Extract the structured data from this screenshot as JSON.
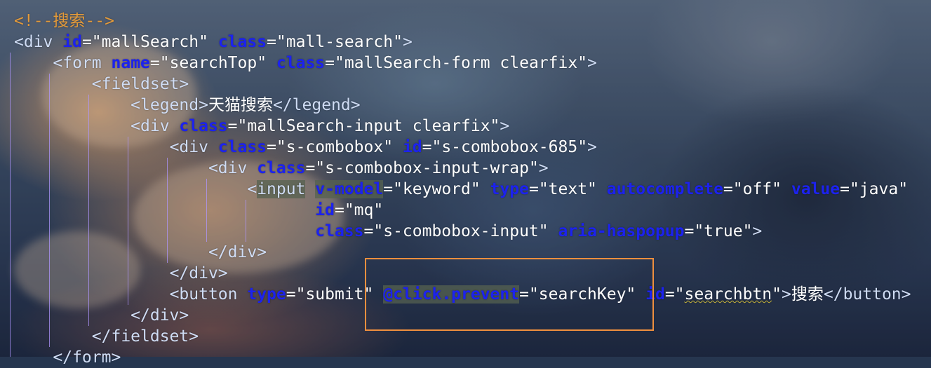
{
  "editor": {
    "lines": [
      {
        "segments": [
          {
            "t": "<!--搜索-->",
            "c": "cmt"
          }
        ]
      },
      {
        "segments": [
          {
            "t": "<div",
            "c": "tag"
          },
          {
            "t": " "
          },
          {
            "t": "id",
            "c": "attr"
          },
          {
            "t": "=\"mallSearch\" ",
            "c": "val"
          },
          {
            "t": "class",
            "c": "attr"
          },
          {
            "t": "=\"mall-search\"",
            "c": "val"
          },
          {
            "t": ">",
            "c": "tag"
          }
        ]
      },
      {
        "segments": [
          {
            "t": "    "
          },
          {
            "t": "<form",
            "c": "tag"
          },
          {
            "t": " "
          },
          {
            "t": "name",
            "c": "attr"
          },
          {
            "t": "=\"searchTop\" ",
            "c": "val"
          },
          {
            "t": "class",
            "c": "attr"
          },
          {
            "t": "=\"mallSearch-form clearfix\"",
            "c": "val"
          },
          {
            "t": ">",
            "c": "tag"
          }
        ]
      },
      {
        "segments": [
          {
            "t": "        "
          },
          {
            "t": "<fieldset>",
            "c": "tag"
          }
        ]
      },
      {
        "segments": [
          {
            "t": "            "
          },
          {
            "t": "<legend>",
            "c": "tag"
          },
          {
            "t": "天猫搜索",
            "c": "val"
          },
          {
            "t": "</legend>",
            "c": "tag"
          }
        ]
      },
      {
        "segments": [
          {
            "t": "            "
          },
          {
            "t": "<div",
            "c": "tag"
          },
          {
            "t": " "
          },
          {
            "t": "class",
            "c": "attr"
          },
          {
            "t": "=\"mallSearch-input clearfix\"",
            "c": "val"
          },
          {
            "t": ">",
            "c": "tag"
          }
        ]
      },
      {
        "segments": [
          {
            "t": "                "
          },
          {
            "t": "<div",
            "c": "tag"
          },
          {
            "t": " "
          },
          {
            "t": "class",
            "c": "attr"
          },
          {
            "t": "=\"s-combobox\" ",
            "c": "val"
          },
          {
            "t": "id",
            "c": "attr"
          },
          {
            "t": "=\"s-combobox-685\"",
            "c": "val"
          },
          {
            "t": ">",
            "c": "tag"
          }
        ]
      },
      {
        "segments": [
          {
            "t": "                    "
          },
          {
            "t": "<div",
            "c": "tag"
          },
          {
            "t": " "
          },
          {
            "t": "class",
            "c": "attr"
          },
          {
            "t": "=\"s-combobox-input-wrap\"",
            "c": "val"
          },
          {
            "t": ">",
            "c": "tag"
          }
        ]
      },
      {
        "segments": [
          {
            "t": "                        "
          },
          {
            "t": "<",
            "c": "tag"
          },
          {
            "t": "input",
            "c": "tag hl"
          },
          {
            "t": " "
          },
          {
            "t": "v-model",
            "c": "attr hl"
          },
          {
            "t": "=\"keyword\" ",
            "c": "val"
          },
          {
            "t": "type",
            "c": "attr"
          },
          {
            "t": "=\"text\" ",
            "c": "val"
          },
          {
            "t": "autocomplete",
            "c": "attr"
          },
          {
            "t": "=\"off\" ",
            "c": "val"
          },
          {
            "t": "value",
            "c": "attr"
          },
          {
            "t": "=\"java\"",
            "c": "val"
          }
        ]
      },
      {
        "segments": [
          {
            "t": "                               "
          },
          {
            "t": "id",
            "c": "attr"
          },
          {
            "t": "=\"mq\"",
            "c": "val"
          }
        ]
      },
      {
        "segments": [
          {
            "t": "                               "
          },
          {
            "t": "class",
            "c": "attr"
          },
          {
            "t": "=\"s-combobox-input\" ",
            "c": "val"
          },
          {
            "t": "aria-haspopup",
            "c": "attr"
          },
          {
            "t": "=\"true\"",
            "c": "val"
          },
          {
            "t": ">",
            "c": "tag"
          }
        ]
      },
      {
        "segments": [
          {
            "t": "                    "
          },
          {
            "t": "</div>",
            "c": "tag"
          }
        ]
      },
      {
        "segments": [
          {
            "t": "                "
          },
          {
            "t": "</div>",
            "c": "tag"
          }
        ]
      },
      {
        "segments": [
          {
            "t": "                "
          },
          {
            "t": "<button",
            "c": "tag"
          },
          {
            "t": " "
          },
          {
            "t": "type",
            "c": "attr"
          },
          {
            "t": "=\"submit\" ",
            "c": "val"
          },
          {
            "t": "@click.prevent",
            "c": "attr hl"
          },
          {
            "t": "=\"searchKey\" ",
            "c": "val"
          },
          {
            "t": "id",
            "c": "attr"
          },
          {
            "t": "=\"",
            "c": "val"
          },
          {
            "t": "searchbtn",
            "c": "val squig"
          },
          {
            "t": "\"",
            "c": "val"
          },
          {
            "t": ">",
            "c": "tag"
          },
          {
            "t": "搜索",
            "c": "val"
          },
          {
            "t": "</button>",
            "c": "tag"
          }
        ]
      },
      {
        "segments": [
          {
            "t": "            "
          },
          {
            "t": "</div>",
            "c": "tag"
          }
        ]
      },
      {
        "segments": [
          {
            "t": "        "
          },
          {
            "t": "</fieldset>",
            "c": "tag"
          }
        ]
      },
      {
        "segments": [
          {
            "t": "    "
          },
          {
            "t": "</form>",
            "c": "tag"
          }
        ]
      }
    ],
    "colors": {
      "tag": "#cfdcf4",
      "attribute": "#1c22ee",
      "value": "#ffffff",
      "comment": "#e39a3a",
      "indent_guide": "#af96ff",
      "callout_frame": "#ef8f3e"
    },
    "callout": {
      "target": "@click.prevent"
    }
  }
}
